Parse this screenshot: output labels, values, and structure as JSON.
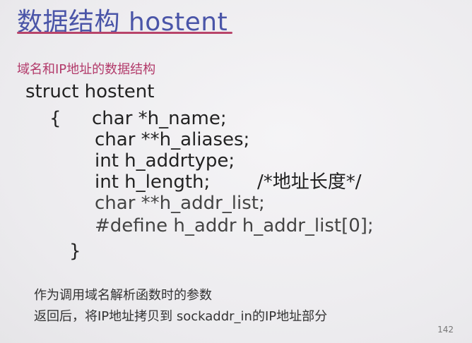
{
  "slide": {
    "title": "数据结构 hostent",
    "subtitle": "域名和IP地址的数据结构",
    "code": {
      "struct_line": "struct hostent",
      "open_brace": "{",
      "field_1": "char *h_name;",
      "field_2": "char **h_aliases;",
      "field_3": "int h_addrtype;",
      "field_4": "int h_length;",
      "field_4_comment": "/*地址长度*/",
      "field_5": "char **h_addr_list;",
      "field_6": "#define h_addr h_addr_list[0];",
      "close_brace": "}"
    },
    "notes": {
      "line_1": "作为调用域名解析函数时的参数",
      "line_2": "返回后，将IP地址拷贝到 sockaddr_in的IP地址部分"
    },
    "page_number": "142"
  },
  "colors": {
    "title": "#4a55a8",
    "underline": "#b8446a",
    "subtitle": "#b23a6a"
  }
}
